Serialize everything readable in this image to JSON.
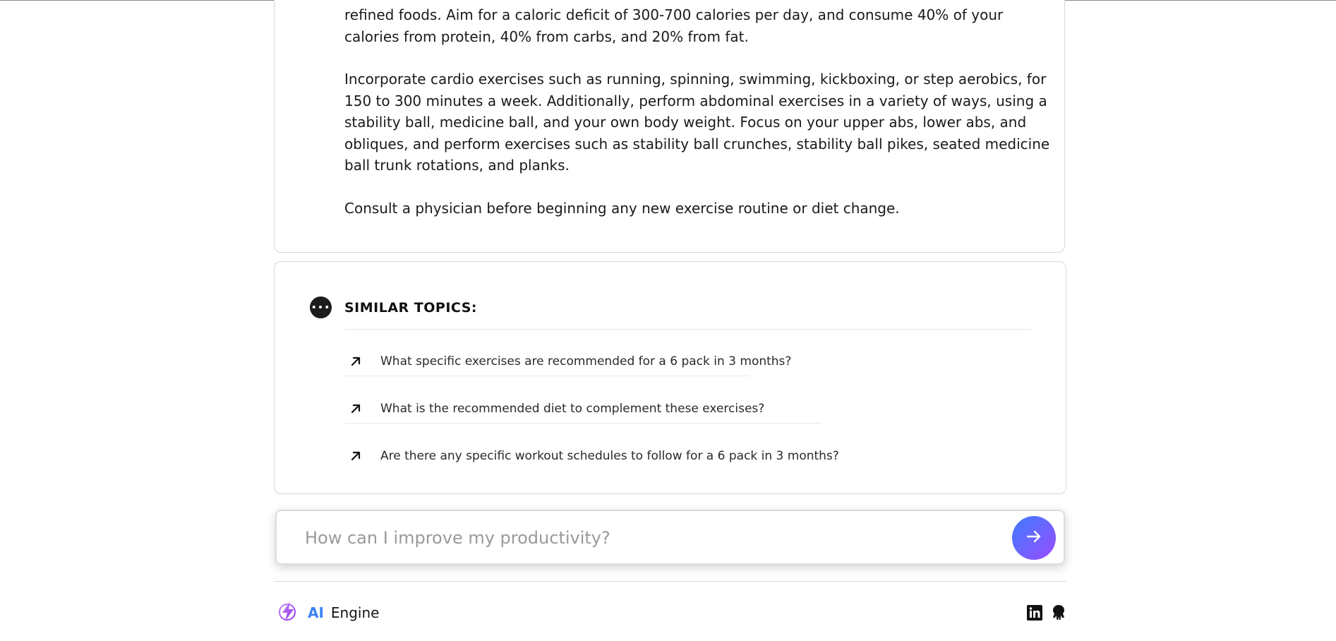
{
  "answer": {
    "paragraphs": [
      "refined foods. Aim for a caloric deficit of 300-700 calories per day, and consume 40% of your calories from protein, 40% from carbs, and 20% from fat.",
      "Incorporate cardio exercises such as running, spinning, swimming, kickboxing, or step aerobics, for 150 to 300 minutes a week. Additionally, perform abdominal exercises in a variety of ways, using a stability ball, medicine ball, and your own body weight. Focus on your upper abs, lower abs, and obliques, and perform exercises such as stability ball crunches, stability ball pikes, seated medicine ball trunk rotations, and planks.",
      "Consult a physician before beginning any new exercise routine or diet change."
    ]
  },
  "similar_topics": {
    "title": "SIMILAR TOPICS:",
    "icon": "more-dots-icon",
    "items": [
      {
        "label": "What specific exercises are recommended for a 6 pack in 3 months?",
        "icon": "arrow-up-right-icon"
      },
      {
        "label": "What is the recommended diet to complement these exercises?",
        "icon": "arrow-up-right-icon"
      },
      {
        "label": "Are there any specific workout schedules to follow for a 6 pack in 3 months?",
        "icon": "arrow-up-right-icon"
      }
    ]
  },
  "search": {
    "placeholder": "How can I improve my productivity?",
    "value": "",
    "send_icon": "arrow-right-icon",
    "send_gradient": [
      "#3d7bff",
      "#9b4dff"
    ]
  },
  "footer": {
    "brand_ai": "AI",
    "brand_engine": "Engine",
    "brand_icon": "lightning-icon",
    "social_icons": [
      "linkedin-icon",
      "github-icon"
    ]
  },
  "colors": {
    "accent": "#3b82f6",
    "brand_purple": "#a855f7"
  }
}
